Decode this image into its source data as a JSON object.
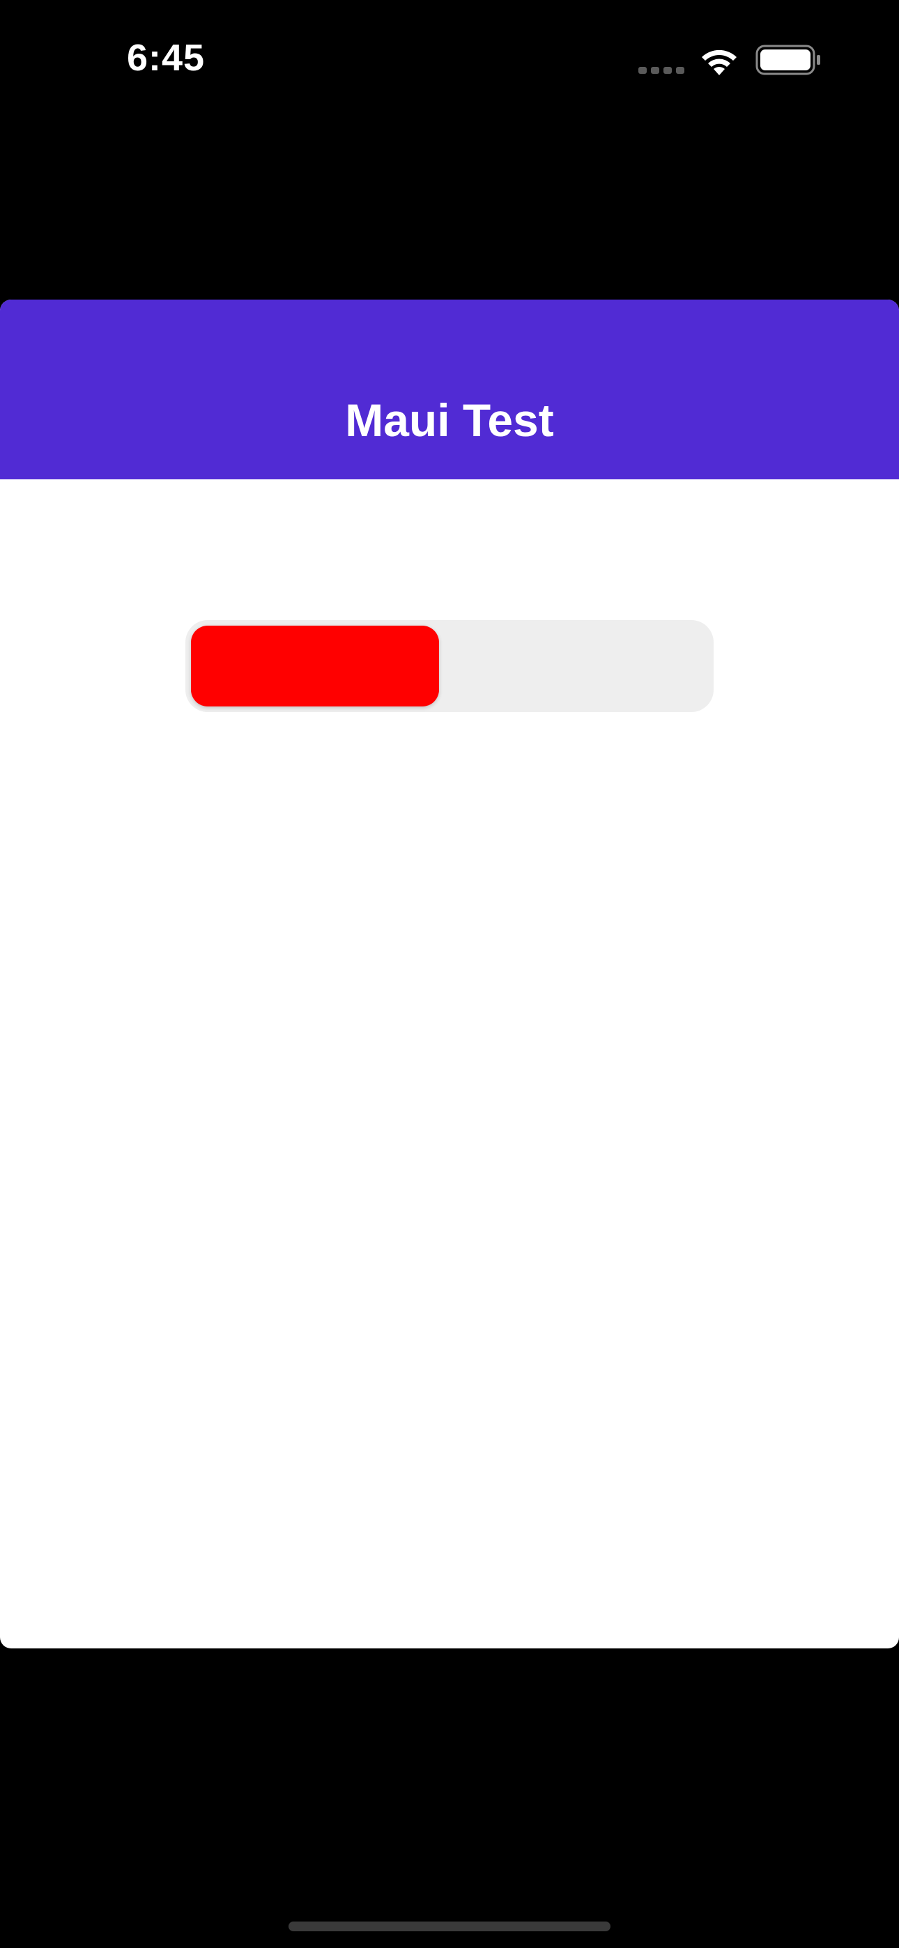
{
  "status_bar": {
    "time": "6:45",
    "icons": [
      "cellular-signal-icon",
      "wifi-icon",
      "battery-icon"
    ]
  },
  "nav_bar": {
    "title": "Maui Test",
    "background_color": "#512bd4",
    "title_color": "#ffffff"
  },
  "progress": {
    "value": 0.48,
    "fill_color": "#ff0000",
    "track_color": "#eeeeee"
  }
}
